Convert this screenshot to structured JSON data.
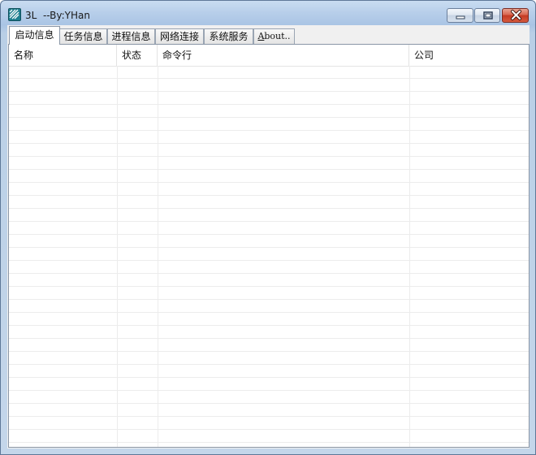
{
  "window": {
    "title": "3L  --By:YHan",
    "controls": {
      "minimize": "minimize",
      "maximize": "maximize",
      "close": "close"
    },
    "icon": "app-logo-icon"
  },
  "tabs": [
    {
      "label": "启动信息",
      "active": true
    },
    {
      "label": "任务信息",
      "active": false
    },
    {
      "label": "进程信息",
      "active": false
    },
    {
      "label": "网络连接",
      "active": false
    },
    {
      "label": "系统服务",
      "active": false
    },
    {
      "label": "About..",
      "active": false
    }
  ],
  "list": {
    "columns": [
      {
        "label": "名称"
      },
      {
        "label": "状态"
      },
      {
        "label": "命令行"
      },
      {
        "label": "公司"
      }
    ],
    "rows": []
  },
  "colors": {
    "title_bar": "#b8cfea",
    "close_button": "#c43a23",
    "grid_line": "#ececec"
  }
}
